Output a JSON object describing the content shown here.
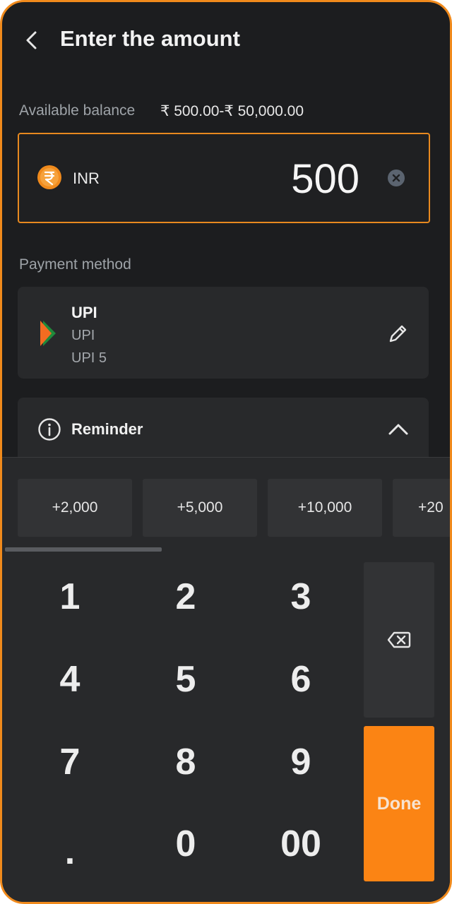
{
  "header": {
    "title": "Enter the amount",
    "back_icon": "chevron-left-icon"
  },
  "balance": {
    "label": "Available balance",
    "value": "₹ 500.00-₹ 50,000.00"
  },
  "amount_input": {
    "currency": "INR",
    "value": "500",
    "currency_icon": "rupee-coin-icon",
    "clear_icon": "clear-icon"
  },
  "payment": {
    "label": "Payment method",
    "method": {
      "title": "UPI",
      "line1": "UPI",
      "line2": "UPI 5",
      "logo": "upi-logo-icon",
      "edit_icon": "pencil-icon"
    }
  },
  "reminder": {
    "title": "Reminder",
    "info_icon": "info-icon",
    "toggle_icon": "chevron-up-icon"
  },
  "quick_amounts": [
    "+2,000",
    "+5,000",
    "+10,000",
    "+20"
  ],
  "keypad": {
    "keys": [
      "1",
      "2",
      "3",
      "4",
      "5",
      "6",
      "7",
      "8",
      "9",
      ".",
      "0",
      "00"
    ],
    "backspace_icon": "backspace-icon",
    "done_label": "Done"
  },
  "colors": {
    "accent": "#fb8414",
    "background": "#1c1d1f",
    "card": "#28292b",
    "border_accent": "#e8891f"
  }
}
